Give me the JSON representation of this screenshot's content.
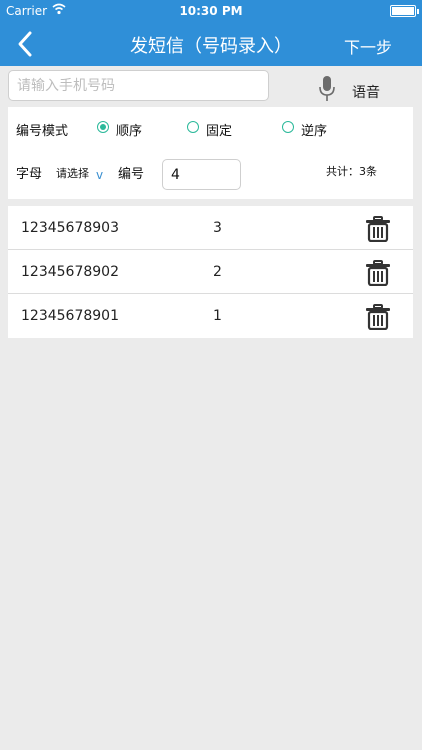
{
  "status_bar": {
    "carrier": "Carrier",
    "time": "10:30 PM"
  },
  "nav": {
    "title": "发短信（号码录入）",
    "next": "下一步",
    "back_icon": "chevron-left-icon"
  },
  "search": {
    "placeholder": "请输入手机号码",
    "value": ""
  },
  "voice": {
    "label": "语音",
    "icon": "microphone-icon"
  },
  "mode": {
    "label": "编号模式",
    "options": [
      {
        "label": "顺序",
        "selected": true
      },
      {
        "label": "固定",
        "selected": false
      },
      {
        "label": "逆序",
        "selected": false
      }
    ]
  },
  "letter": {
    "label": "字母",
    "select_value": "请选择"
  },
  "number": {
    "label": "编号",
    "value": "4"
  },
  "total": "共计：3条",
  "records": [
    {
      "phone": "12345678903",
      "seq": "3"
    },
    {
      "phone": "12345678902",
      "seq": "2"
    },
    {
      "phone": "12345678901",
      "seq": "1"
    }
  ],
  "colors": {
    "nav_bg": "#2f8fd8",
    "radio": "#2bb99a",
    "page_bg": "#ebebeb"
  }
}
